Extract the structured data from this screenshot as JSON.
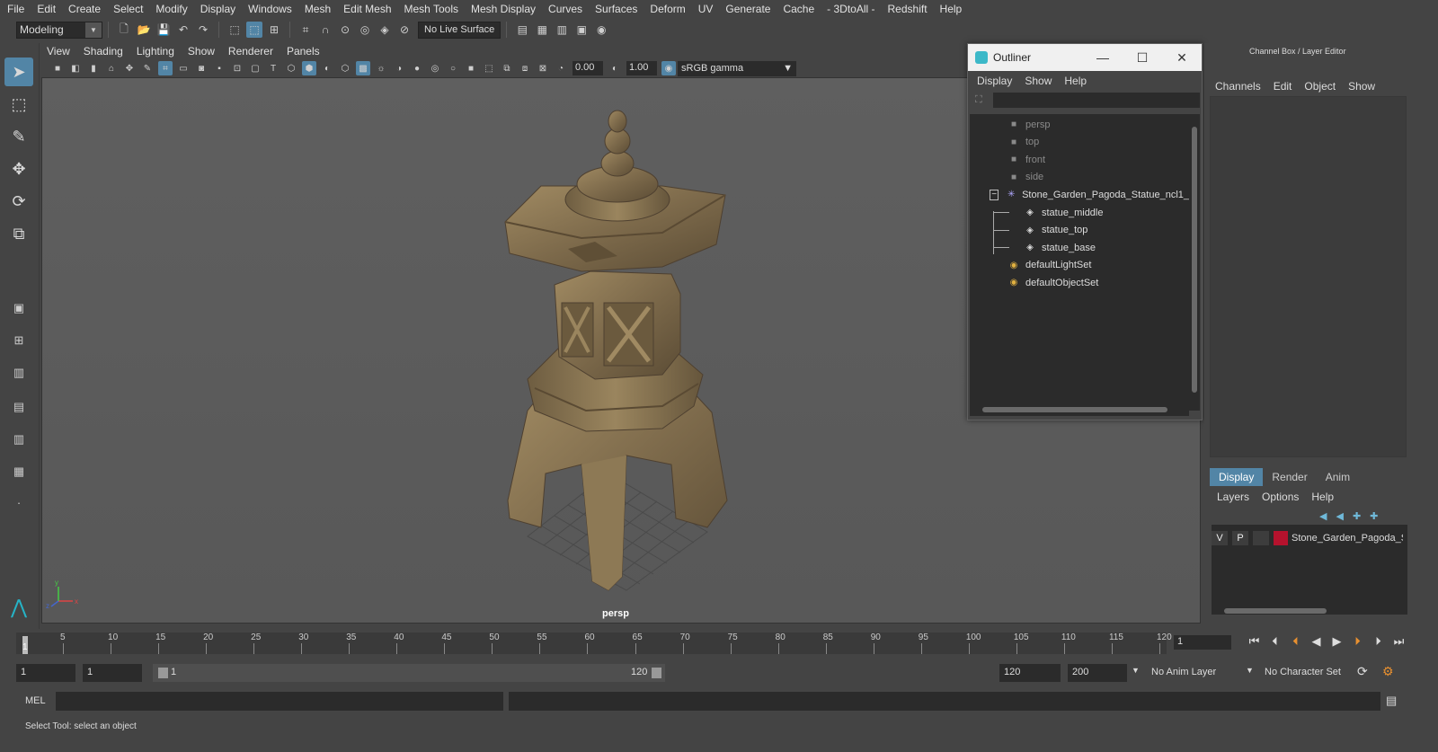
{
  "menubar": [
    "File",
    "Edit",
    "Create",
    "Select",
    "Modify",
    "Display",
    "Windows",
    "Mesh",
    "Edit Mesh",
    "Mesh Tools",
    "Mesh Display",
    "Curves",
    "Surfaces",
    "Deform",
    "UV",
    "Generate",
    "Cache",
    "- 3DtoAll -",
    "Redshift",
    "Help"
  ],
  "toolbar": {
    "mode": "Modeling",
    "live_surface": "No Live Surface"
  },
  "viewport": {
    "menu": [
      "View",
      "Shading",
      "Lighting",
      "Show",
      "Renderer",
      "Panels"
    ],
    "exposure": "0.00",
    "gamma": "1.00",
    "color_space": "sRGB gamma",
    "camera_label": "persp",
    "axis": {
      "x": "x",
      "y": "y",
      "z": "z"
    }
  },
  "outliner": {
    "title": "Outliner",
    "menu": [
      "Display",
      "Show",
      "Help"
    ],
    "items": [
      {
        "label": "persp",
        "icon": "camera-icon",
        "dim": true
      },
      {
        "label": "top",
        "icon": "camera-icon",
        "dim": true
      },
      {
        "label": "front",
        "icon": "camera-icon",
        "dim": true
      },
      {
        "label": "side",
        "icon": "camera-icon",
        "dim": true
      },
      {
        "label": "Stone_Garden_Pagoda_Statue_ncl1_",
        "icon": "group-icon",
        "dim": false
      },
      {
        "label": "statue_middle",
        "icon": "mesh-icon",
        "dim": false
      },
      {
        "label": "statue_top",
        "icon": "mesh-icon",
        "dim": false
      },
      {
        "label": "statue_base",
        "icon": "mesh-icon",
        "dim": false
      },
      {
        "label": "defaultLightSet",
        "icon": "set-icon",
        "dim": false
      },
      {
        "label": "defaultObjectSet",
        "icon": "set-icon",
        "dim": false
      }
    ]
  },
  "channel_box": {
    "title": "Channel Box / Layer Editor",
    "menu": [
      "Channels",
      "Edit",
      "Object",
      "Show"
    ],
    "tabs": [
      "Display",
      "Render",
      "Anim"
    ],
    "layer_menu": [
      "Layers",
      "Options",
      "Help"
    ],
    "layer": {
      "v": "V",
      "p": "P",
      "name": "Stone_Garden_Pagoda_S",
      "color": "#b5122d"
    }
  },
  "timeline": {
    "ticks": [
      "5",
      "10",
      "15",
      "20",
      "25",
      "30",
      "35",
      "40",
      "45",
      "50",
      "55",
      "60",
      "65",
      "70",
      "75",
      "80",
      "85",
      "90",
      "95",
      "100",
      "105",
      "110",
      "115",
      "120"
    ],
    "current_tick": "1",
    "current_frame": "1"
  },
  "range": {
    "start": "1",
    "inner_start": "1",
    "slider_start": "1",
    "slider_end": "120",
    "end": "120",
    "max": "200",
    "anim_layer": "No Anim Layer",
    "char_set": "No Character Set"
  },
  "mel": {
    "label": "MEL"
  },
  "status": {
    "text": "Select Tool: select an object"
  },
  "colors": {
    "accent": "#5285a6",
    "stone": "#8a7556"
  }
}
